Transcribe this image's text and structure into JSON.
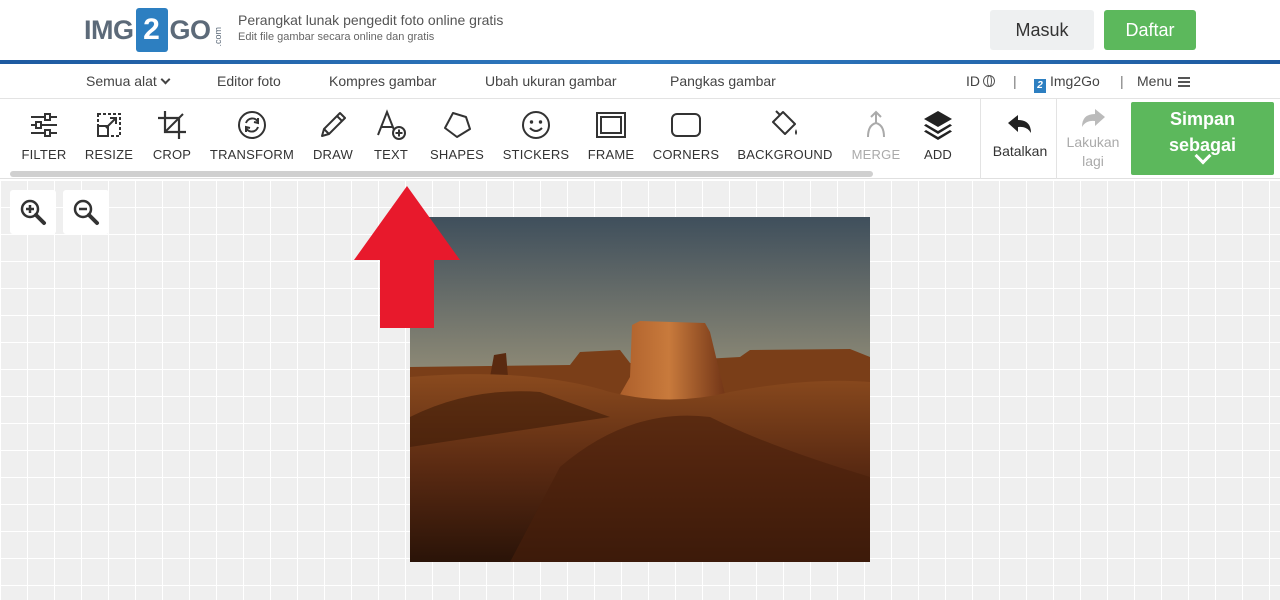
{
  "header": {
    "logo": {
      "left": "IMG",
      "box": "2",
      "right": "GO",
      "suffix": ".com"
    },
    "tagline_title": "Perangkat lunak pengedit foto online gratis",
    "tagline_sub": "Edit file gambar secara online dan gratis",
    "login_label": "Masuk",
    "register_label": "Daftar"
  },
  "nav": {
    "all_tools": "Semua alat",
    "items": [
      "Editor foto",
      "Kompres gambar",
      "Ubah ukuran gambar",
      "Pangkas gambar"
    ],
    "language": "ID",
    "separator": "|",
    "brand": "Img2Go",
    "brand_icon": "2",
    "menu": "Menu"
  },
  "toolbar": {
    "tools": [
      {
        "label": "FILTER",
        "icon": "sliders-icon"
      },
      {
        "label": "RESIZE",
        "icon": "resize-icon"
      },
      {
        "label": "CROP",
        "icon": "crop-icon"
      },
      {
        "label": "TRANSFORM",
        "icon": "rotate-icon"
      },
      {
        "label": "DRAW",
        "icon": "pencil-icon"
      },
      {
        "label": "TEXT",
        "icon": "text-icon"
      },
      {
        "label": "SHAPES",
        "icon": "pentagon-icon"
      },
      {
        "label": "STICKERS",
        "icon": "smiley-icon"
      },
      {
        "label": "FRAME",
        "icon": "frame-icon"
      },
      {
        "label": "CORNERS",
        "icon": "rounded-rect-icon"
      },
      {
        "label": "BACKGROUND",
        "icon": "paint-bucket-icon"
      },
      {
        "label": "MERGE",
        "icon": "merge-icon"
      },
      {
        "label": "ADD",
        "icon": "layers-icon"
      }
    ],
    "undo_label": "Batalkan",
    "redo_label_1": "Lakukan",
    "redo_label_2": "lagi",
    "save_label_1": "Simpan",
    "save_label_2": "sebagai"
  },
  "colors": {
    "accent_green": "#5cb85c",
    "brand_blue": "#2d7fc1",
    "arrow_red": "#e8192c"
  }
}
